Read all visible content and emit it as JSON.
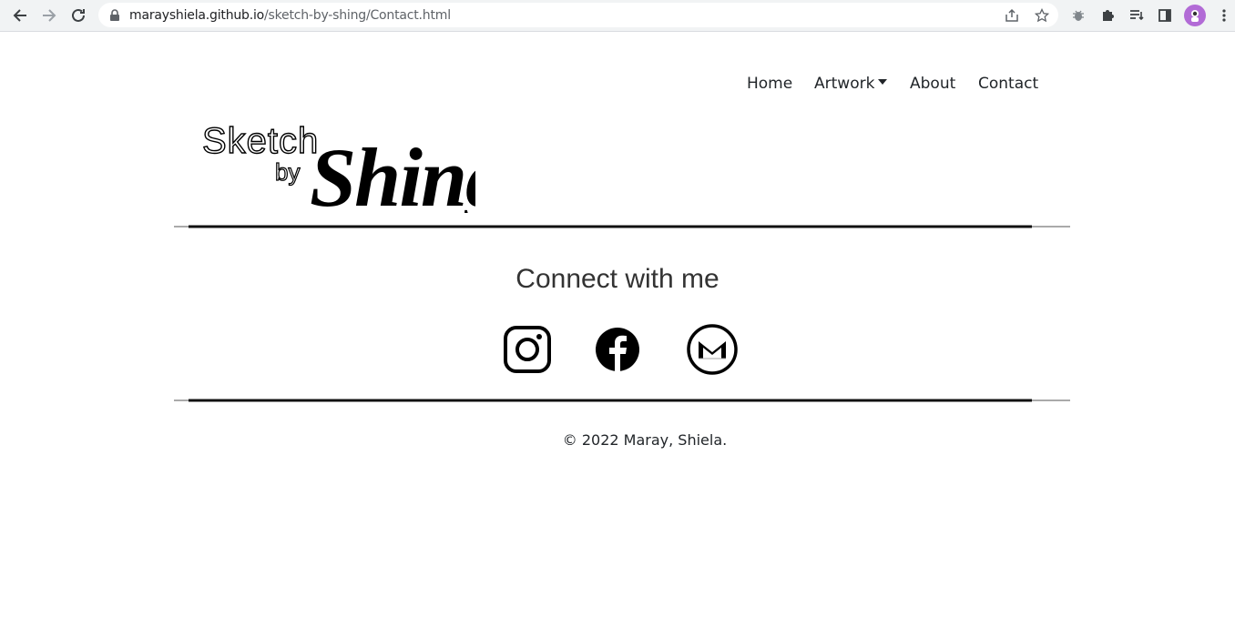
{
  "browser": {
    "url_host": "marayshiela.github.io",
    "url_path": "/sketch-by-shing/Contact.html"
  },
  "nav": {
    "items": [
      {
        "label": "Home"
      },
      {
        "label": "Artwork"
      },
      {
        "label": "About"
      },
      {
        "label": "Contact"
      }
    ]
  },
  "logo": {
    "line1": "Sketch",
    "line2": "by",
    "line3": "Shing"
  },
  "contact": {
    "heading": "Connect with me",
    "social": [
      "instagram-icon",
      "facebook-icon",
      "gmail-icon"
    ]
  },
  "footer": {
    "copyright": "© 2022 Maray, Shiela."
  },
  "colors": {
    "text": "#212529",
    "chrome": "#f1f3f4"
  }
}
